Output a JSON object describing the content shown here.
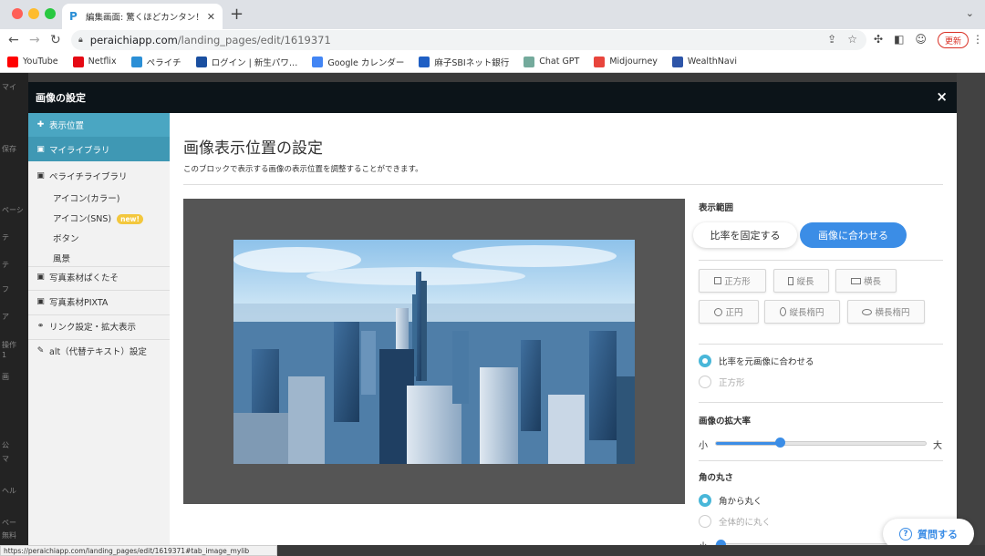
{
  "browser": {
    "tab_title": "編集画面: 驚くほどカンタン！無料",
    "url_host": "peraichiapp.com",
    "url_path": "/landing_pages/edit/1619371",
    "update_label": "更新",
    "bookmarks": [
      {
        "label": "YouTube",
        "icon": "youtube-icon",
        "color": "#ff0000"
      },
      {
        "label": "Netflix",
        "icon": "netflix-icon",
        "color": "#e50914"
      },
      {
        "label": "ペライチ",
        "icon": "peraichi-icon",
        "color": "#2b8fd6"
      },
      {
        "label": "ログイン | 新生パワ…",
        "icon": "shinsei-icon",
        "color": "#1a4fa0"
      },
      {
        "label": "Google カレンダー",
        "icon": "google-calendar-icon",
        "color": "#4285f4"
      },
      {
        "label": "麻子SBIネット銀行",
        "icon": "sbi-icon",
        "color": "#1f5fc4"
      },
      {
        "label": "Chat GPT",
        "icon": "chatgpt-icon",
        "color": "#74aa9c"
      },
      {
        "label": "Midjourney",
        "icon": "midjourney-icon",
        "color": "#e8453c"
      },
      {
        "label": "WealthNavi",
        "icon": "wealthnavi-icon",
        "color": "#2d55a8"
      }
    ],
    "status_url": "https://peraichiapp.com/landing_pages/edit/1619371#tab_image_mylib"
  },
  "background_page": {
    "left_items": [
      "マイ",
      "保存",
      "ペーシ",
      "テ",
      "テ",
      "フ",
      "ア",
      "操作",
      "1",
      "画",
      "公",
      "マ",
      "ヘル",
      "ペー",
      "無料"
    ]
  },
  "modal": {
    "title": "画像の設定",
    "close_glyph": "×"
  },
  "sidebar": {
    "items": [
      {
        "label": "表示位置",
        "icon": "plus-icon",
        "glyph": "✚"
      },
      {
        "label": "マイライブラリ",
        "icon": "image-icon",
        "glyph": "▣"
      },
      {
        "label": "ペライチライブラリ",
        "icon": "image-icon",
        "glyph": "▣"
      },
      {
        "label": "写真素材ぱくたそ",
        "icon": "image-icon",
        "glyph": "▣"
      },
      {
        "label": "写真素材PIXTA",
        "icon": "image-icon",
        "glyph": "▣"
      },
      {
        "label": "リンク設定・拡大表示",
        "icon": "link-icon",
        "glyph": "⚭"
      },
      {
        "label": "alt（代替テキスト）設定",
        "icon": "pencil-icon",
        "glyph": "✎"
      }
    ],
    "sub_items": [
      "アイコン(カラー)",
      "アイコン(SNS)",
      "ボタン",
      "風景"
    ],
    "new_badge": "new!"
  },
  "main": {
    "title": "画像表示位置の設定",
    "description": "このブロックで表示する画像の表示位置を調整することができます。"
  },
  "panel": {
    "range_label": "表示範囲",
    "fix_ratio_label": "比率を固定する",
    "fit_image_label": "画像に合わせる",
    "shapes": [
      "正方形",
      "縦長",
      "横長",
      "正円",
      "縦長楕円",
      "横長楕円"
    ],
    "ratio_options": [
      "比率を元画像に合わせる",
      "正方形"
    ],
    "zoom_label": "画像の拡大率",
    "zoom_small": "小",
    "zoom_large": "大",
    "zoom_level": 0.3,
    "corner_label": "角の丸さ",
    "corner_options": [
      "角から丸く",
      "全体的に丸く"
    ],
    "corner_small": "小",
    "corner_level": 0.0
  },
  "help": {
    "label": "質問する",
    "icon_glyph": "?"
  }
}
